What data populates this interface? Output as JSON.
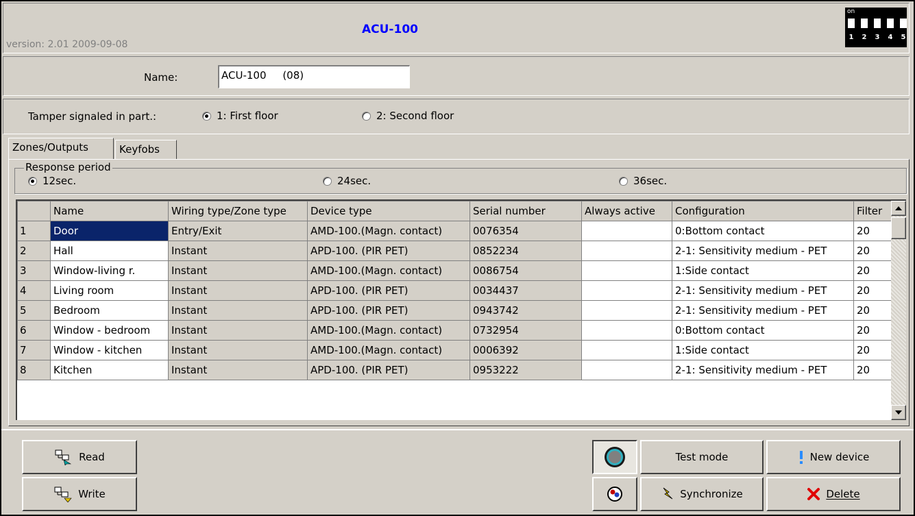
{
  "header": {
    "version": "version: 2.01 2009-09-08",
    "title": "ACU-100",
    "dip": {
      "on_label": "on",
      "numbers": [
        "1",
        "2",
        "3",
        "4",
        "5"
      ]
    }
  },
  "name_row": {
    "label": "Name:",
    "value": "ACU-100     (08)"
  },
  "tamper": {
    "label": "Tamper signaled in part.:",
    "options": [
      "1: First floor",
      "2: Second floor"
    ],
    "selected": 0
  },
  "tabs": [
    "Zones/Outputs",
    "Keyfobs"
  ],
  "response": {
    "group_label": "Response period",
    "options": [
      "12sec.",
      "24sec.",
      "36sec."
    ],
    "selected": 0
  },
  "table": {
    "columns": [
      "",
      "Name",
      "Wiring type/Zone type",
      "Device type",
      "Serial number",
      "Always active",
      "Configuration",
      "Filter"
    ],
    "rows": [
      [
        "1",
        "Door",
        "Entry/Exit",
        "AMD-100.(Magn. contact)",
        "0076354",
        "",
        "0:Bottom contact",
        "20"
      ],
      [
        "2",
        "Hall",
        "Instant",
        "APD-100. (PIR PET)",
        "0852234",
        "",
        "2-1: Sensitivity medium - PET",
        "20"
      ],
      [
        "3",
        "Window-living r.",
        "Instant",
        "AMD-100.(Magn. contact)",
        "0086754",
        "",
        "1:Side contact",
        "20"
      ],
      [
        "4",
        "Living room",
        "Instant",
        "APD-100. (PIR PET)",
        "0034437",
        "",
        "2-1: Sensitivity medium - PET",
        "20"
      ],
      [
        "5",
        "Bedroom",
        "Instant",
        "APD-100. (PIR PET)",
        "0943742",
        "",
        "2-1: Sensitivity medium - PET",
        "20"
      ],
      [
        "6",
        "Window - bedroom",
        "Instant",
        "AMD-100.(Magn. contact)",
        "0732954",
        "",
        "0:Bottom contact",
        "20"
      ],
      [
        "7",
        "Window - kitchen",
        "Instant",
        "AMD-100.(Magn. contact)",
        "0006392",
        "",
        "1:Side contact",
        "20"
      ],
      [
        "8",
        "Kitchen",
        "Instant",
        "APD-100. (PIR PET)",
        "0953222",
        "",
        "2-1: Sensitivity medium - PET",
        "20"
      ]
    ]
  },
  "buttons": {
    "read": "Read",
    "write": "Write",
    "test_mode": "Test mode",
    "synchronize": "Synchronize",
    "new_device": "New device",
    "delete": "Delete"
  },
  "colors": {
    "title": "#0000ff",
    "selection": "#0a246a",
    "face": "#d4d0c8"
  }
}
